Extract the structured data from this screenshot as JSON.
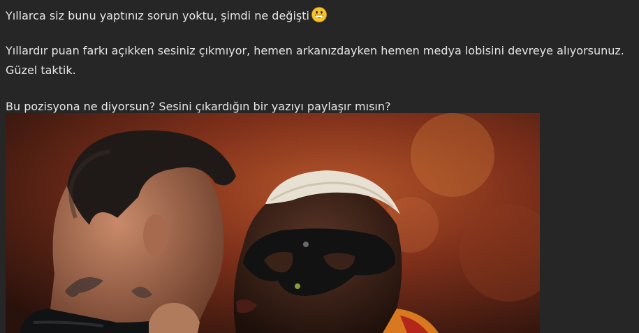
{
  "post": {
    "line1": "Yıllarca siz bunu yaptınız sorun yoktu, şimdi ne değişti",
    "line1_emoji": "grinning-face-emoji",
    "line2": "Yıllardır puan farkı açıkken sesiniz çıkmıyor, hemen arkanızdayken hemen medya lobisini devreye alıyorsunuz.",
    "line3": "Güzel taktik.",
    "line4": "Bu pozisyona ne diyorsun? Sesini çıkardığın bir yazıyı paylaşır mısın?",
    "image": {
      "subject": "two-football-players-face-to-face-photo"
    }
  },
  "colors": {
    "background": "#262626",
    "text": "#e6e6e6",
    "emoji_face": "#f7c52b"
  }
}
